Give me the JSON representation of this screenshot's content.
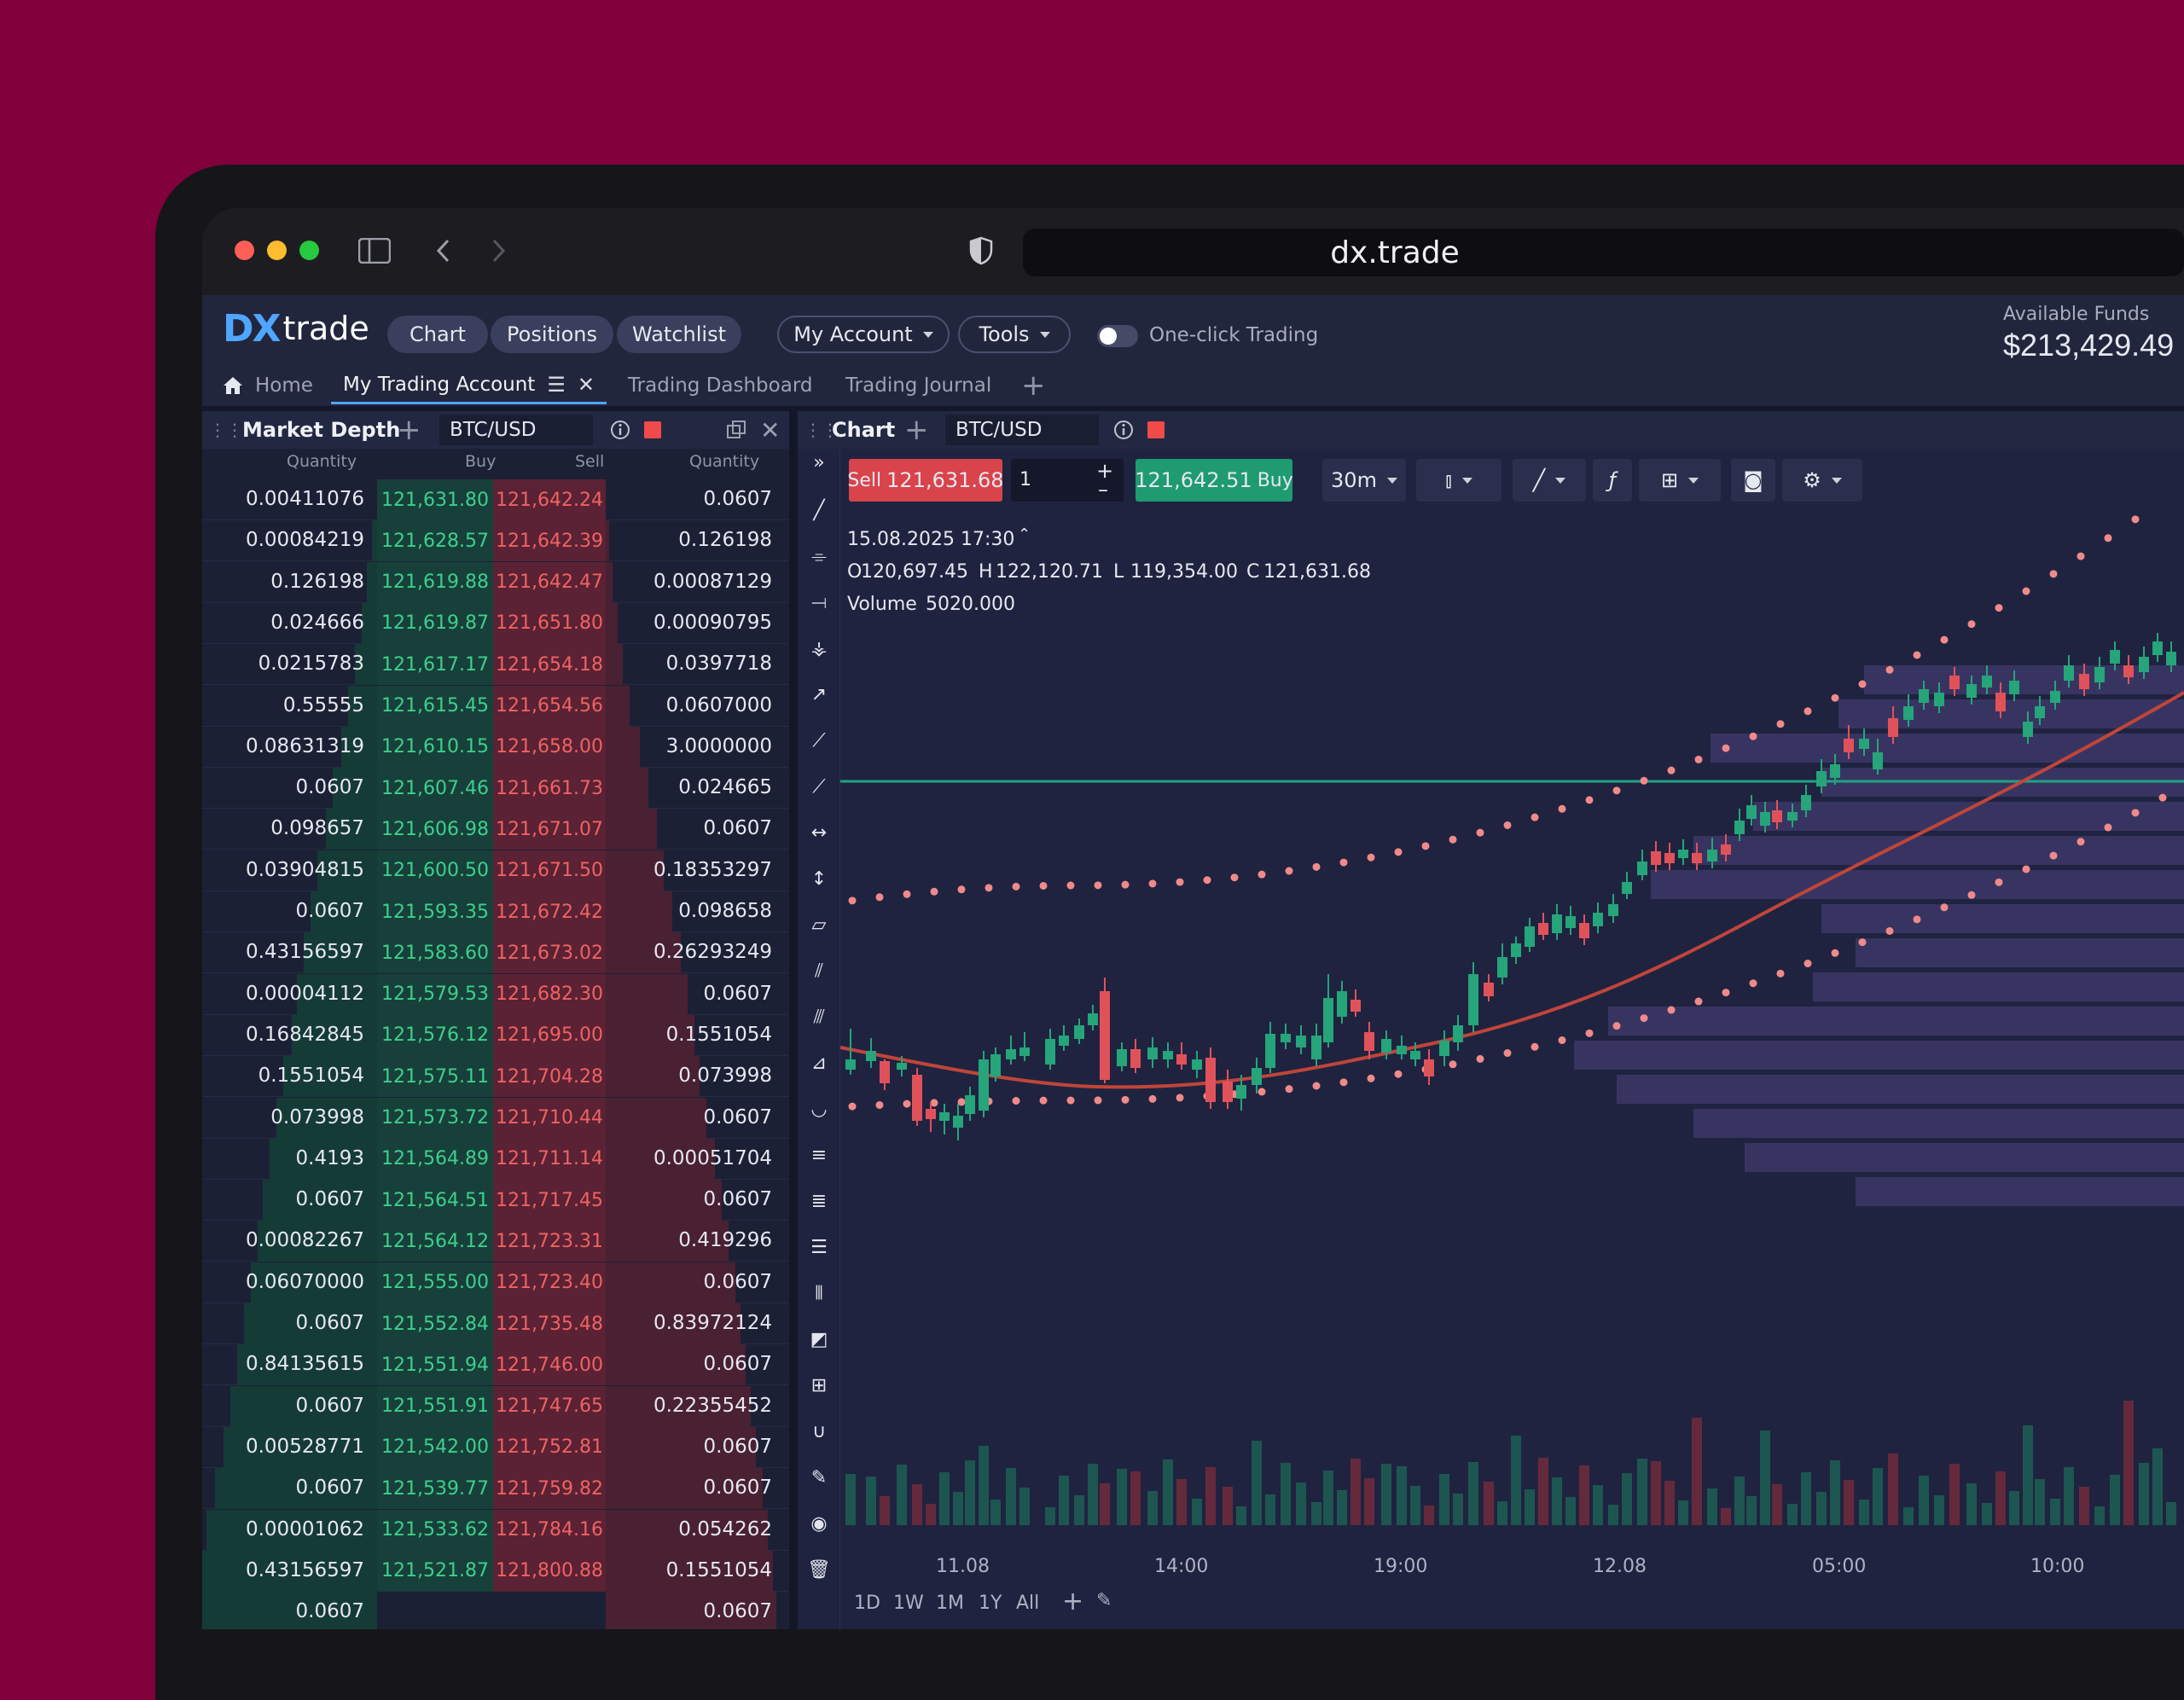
{
  "browser": {
    "url": "dx.trade",
    "traffic_lights": [
      "#fe5f57",
      "#febc2e",
      "#28c840"
    ],
    "icons": [
      "sidebar-icon",
      "back-icon",
      "forward-icon",
      "shield-icon"
    ]
  },
  "app": {
    "logo_dx": "DX",
    "logo_trade": "trade",
    "nav": [
      "Chart",
      "Positions",
      "Watchlist"
    ],
    "menus": [
      "My Account",
      "Tools"
    ],
    "one_click_label": "One-click Trading",
    "available_funds_label": "Available Funds",
    "available_funds_value": "$213,429.49",
    "tabs": {
      "home": "Home",
      "account": "My Trading Account",
      "dashboard": "Trading Dashboard",
      "journal": "Trading Journal"
    }
  },
  "market_depth": {
    "title": "Market Depth",
    "symbol": "BTC/USD",
    "headers": {
      "q1": "Quantity",
      "buy": "Buy",
      "sell": "Sell",
      "q2": "Quantity"
    },
    "rows": [
      {
        "bq": "0.00411076",
        "bid": "121,631.80",
        "ask": "121,642.24",
        "aq": "0.0607"
      },
      {
        "bq": "0.00084219",
        "bid": "121,628.57",
        "ask": "121,642.39",
        "aq": "0.126198"
      },
      {
        "bq": "0.126198",
        "bid": "121,619.88",
        "ask": "121,642.47",
        "aq": "0.00087129"
      },
      {
        "bq": "0.024666",
        "bid": "121,619.87",
        "ask": "121,651.80",
        "aq": "0.00090795"
      },
      {
        "bq": "0.0215783",
        "bid": "121,617.17",
        "ask": "121,654.18",
        "aq": "0.0397718"
      },
      {
        "bq": "0.55555",
        "bid": "121,615.45",
        "ask": "121,654.56",
        "aq": "0.0607000"
      },
      {
        "bq": "0.08631319",
        "bid": "121,610.15",
        "ask": "121,658.00",
        "aq": "3.0000000"
      },
      {
        "bq": "0.0607",
        "bid": "121,607.46",
        "ask": "121,661.73",
        "aq": "0.024665"
      },
      {
        "bq": "0.098657",
        "bid": "121,606.98",
        "ask": "121,671.07",
        "aq": "0.0607"
      },
      {
        "bq": "0.03904815",
        "bid": "121,600.50",
        "ask": "121,671.50",
        "aq": "0.18353297"
      },
      {
        "bq": "0.0607",
        "bid": "121,593.35",
        "ask": "121,672.42",
        "aq": "0.098658"
      },
      {
        "bq": "0.43156597",
        "bid": "121,583.60",
        "ask": "121,673.02",
        "aq": "0.26293249"
      },
      {
        "bq": "0.00004112",
        "bid": "121,579.53",
        "ask": "121,682.30",
        "aq": "0.0607"
      },
      {
        "bq": "0.16842845",
        "bid": "121,576.12",
        "ask": "121,695.00",
        "aq": "0.1551054"
      },
      {
        "bq": "0.1551054",
        "bid": "121,575.11",
        "ask": "121,704.28",
        "aq": "0.073998"
      },
      {
        "bq": "0.073998",
        "bid": "121,573.72",
        "ask": "121,710.44",
        "aq": "0.0607"
      },
      {
        "bq": "0.4193",
        "bid": "121,564.89",
        "ask": "121,711.14",
        "aq": "0.00051704"
      },
      {
        "bq": "0.0607",
        "bid": "121,564.51",
        "ask": "121,717.45",
        "aq": "0.0607"
      },
      {
        "bq": "0.00082267",
        "bid": "121,564.12",
        "ask": "121,723.31",
        "aq": "0.419296"
      },
      {
        "bq": "0.06070000",
        "bid": "121,555.00",
        "ask": "121,723.40",
        "aq": "0.0607"
      },
      {
        "bq": "0.0607",
        "bid": "121,552.84",
        "ask": "121,735.48",
        "aq": "0.83972124"
      },
      {
        "bq": "0.84135615",
        "bid": "121,551.94",
        "ask": "121,746.00",
        "aq": "0.0607"
      },
      {
        "bq": "0.0607",
        "bid": "121,551.91",
        "ask": "121,747.65",
        "aq": "0.22355452"
      },
      {
        "bq": "0.00528771",
        "bid": "121,542.00",
        "ask": "121,752.81",
        "aq": "0.0607"
      },
      {
        "bq": "0.0607",
        "bid": "121,539.77",
        "ask": "121,759.82",
        "aq": "0.0607"
      },
      {
        "bq": "0.00001062",
        "bid": "121,533.62",
        "ask": "121,784.16",
        "aq": "0.054262"
      },
      {
        "bq": "0.43156597",
        "bid": "121,521.87",
        "ask": "121,800.88",
        "aq": "0.1551054"
      },
      {
        "bq": "0.0607",
        "bid": "",
        "ask": "",
        "aq": "0.0607"
      }
    ]
  },
  "chart": {
    "title": "Chart",
    "symbol": "BTC/USD",
    "sell_label": "Sell",
    "sell_price": "121,631.68",
    "buy_price": "121,642.51",
    "buy_label": "Buy",
    "quantity": "1",
    "timeframe": "30m",
    "ohlc": {
      "date": "15.08.2025 17:30",
      "o_label": "O",
      "o": "120,697.45",
      "h_label": "H",
      "h": "122,120.71",
      "l_label": "L",
      "l": "119,354.00",
      "c_label": "C",
      "c": "121,631.68",
      "vol_label": "Volume",
      "vol": "5020.000"
    },
    "x_ticks": [
      "11.08",
      "14:00",
      "19:00",
      "12.08",
      "05:00",
      "10:00"
    ],
    "periods": [
      "1D",
      "1W",
      "1M",
      "1Y",
      "All"
    ],
    "colors": {
      "up": "#26a47a",
      "down": "#e0525a",
      "ma": "#c0453a",
      "dots": "#f08a8a",
      "hline": "#1fa383"
    }
  }
}
